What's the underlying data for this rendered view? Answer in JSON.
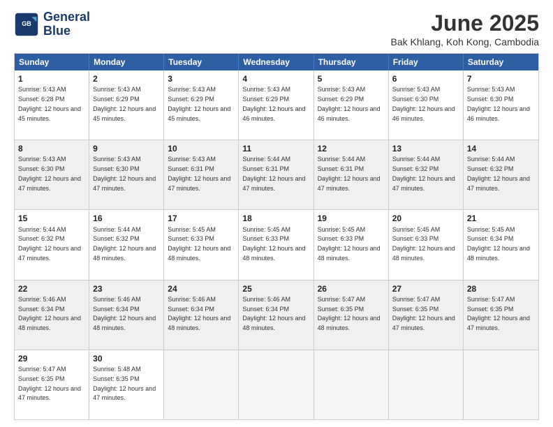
{
  "logo": {
    "line1": "General",
    "line2": "Blue"
  },
  "title": "June 2025",
  "location": "Bak Khlang, Koh Kong, Cambodia",
  "days": [
    "Sunday",
    "Monday",
    "Tuesday",
    "Wednesday",
    "Thursday",
    "Friday",
    "Saturday"
  ],
  "weeks": [
    [
      {
        "day": "1",
        "sunrise": "5:43 AM",
        "sunset": "6:28 PM",
        "daylight": "12 hours and 45 minutes."
      },
      {
        "day": "2",
        "sunrise": "5:43 AM",
        "sunset": "6:29 PM",
        "daylight": "12 hours and 45 minutes."
      },
      {
        "day": "3",
        "sunrise": "5:43 AM",
        "sunset": "6:29 PM",
        "daylight": "12 hours and 45 minutes."
      },
      {
        "day": "4",
        "sunrise": "5:43 AM",
        "sunset": "6:29 PM",
        "daylight": "12 hours and 46 minutes."
      },
      {
        "day": "5",
        "sunrise": "5:43 AM",
        "sunset": "6:29 PM",
        "daylight": "12 hours and 46 minutes."
      },
      {
        "day": "6",
        "sunrise": "5:43 AM",
        "sunset": "6:30 PM",
        "daylight": "12 hours and 46 minutes."
      },
      {
        "day": "7",
        "sunrise": "5:43 AM",
        "sunset": "6:30 PM",
        "daylight": "12 hours and 46 minutes."
      }
    ],
    [
      {
        "day": "8",
        "sunrise": "5:43 AM",
        "sunset": "6:30 PM",
        "daylight": "12 hours and 47 minutes."
      },
      {
        "day": "9",
        "sunrise": "5:43 AM",
        "sunset": "6:30 PM",
        "daylight": "12 hours and 47 minutes."
      },
      {
        "day": "10",
        "sunrise": "5:43 AM",
        "sunset": "6:31 PM",
        "daylight": "12 hours and 47 minutes."
      },
      {
        "day": "11",
        "sunrise": "5:44 AM",
        "sunset": "6:31 PM",
        "daylight": "12 hours and 47 minutes."
      },
      {
        "day": "12",
        "sunrise": "5:44 AM",
        "sunset": "6:31 PM",
        "daylight": "12 hours and 47 minutes."
      },
      {
        "day": "13",
        "sunrise": "5:44 AM",
        "sunset": "6:32 PM",
        "daylight": "12 hours and 47 minutes."
      },
      {
        "day": "14",
        "sunrise": "5:44 AM",
        "sunset": "6:32 PM",
        "daylight": "12 hours and 47 minutes."
      }
    ],
    [
      {
        "day": "15",
        "sunrise": "5:44 AM",
        "sunset": "6:32 PM",
        "daylight": "12 hours and 47 minutes."
      },
      {
        "day": "16",
        "sunrise": "5:44 AM",
        "sunset": "6:32 PM",
        "daylight": "12 hours and 48 minutes."
      },
      {
        "day": "17",
        "sunrise": "5:45 AM",
        "sunset": "6:33 PM",
        "daylight": "12 hours and 48 minutes."
      },
      {
        "day": "18",
        "sunrise": "5:45 AM",
        "sunset": "6:33 PM",
        "daylight": "12 hours and 48 minutes."
      },
      {
        "day": "19",
        "sunrise": "5:45 AM",
        "sunset": "6:33 PM",
        "daylight": "12 hours and 48 minutes."
      },
      {
        "day": "20",
        "sunrise": "5:45 AM",
        "sunset": "6:33 PM",
        "daylight": "12 hours and 48 minutes."
      },
      {
        "day": "21",
        "sunrise": "5:45 AM",
        "sunset": "6:34 PM",
        "daylight": "12 hours and 48 minutes."
      }
    ],
    [
      {
        "day": "22",
        "sunrise": "5:46 AM",
        "sunset": "6:34 PM",
        "daylight": "12 hours and 48 minutes."
      },
      {
        "day": "23",
        "sunrise": "5:46 AM",
        "sunset": "6:34 PM",
        "daylight": "12 hours and 48 minutes."
      },
      {
        "day": "24",
        "sunrise": "5:46 AM",
        "sunset": "6:34 PM",
        "daylight": "12 hours and 48 minutes."
      },
      {
        "day": "25",
        "sunrise": "5:46 AM",
        "sunset": "6:34 PM",
        "daylight": "12 hours and 48 minutes."
      },
      {
        "day": "26",
        "sunrise": "5:47 AM",
        "sunset": "6:35 PM",
        "daylight": "12 hours and 48 minutes."
      },
      {
        "day": "27",
        "sunrise": "5:47 AM",
        "sunset": "6:35 PM",
        "daylight": "12 hours and 47 minutes."
      },
      {
        "day": "28",
        "sunrise": "5:47 AM",
        "sunset": "6:35 PM",
        "daylight": "12 hours and 47 minutes."
      }
    ],
    [
      {
        "day": "29",
        "sunrise": "5:47 AM",
        "sunset": "6:35 PM",
        "daylight": "12 hours and 47 minutes."
      },
      {
        "day": "30",
        "sunrise": "5:48 AM",
        "sunset": "6:35 PM",
        "daylight": "12 hours and 47 minutes."
      },
      null,
      null,
      null,
      null,
      null
    ]
  ]
}
